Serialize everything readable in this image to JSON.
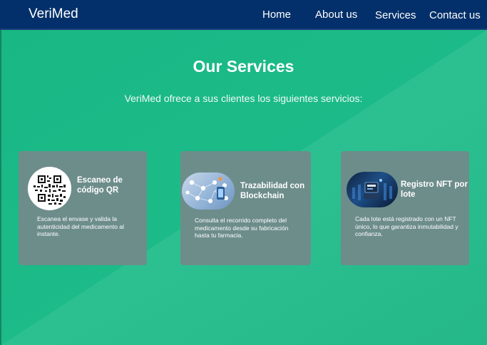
{
  "navbar": {
    "brand": "VeriMed",
    "links": [
      "Home",
      "About us",
      "Services",
      "Contact us"
    ]
  },
  "hero": {
    "title": "Our Services",
    "subtitle": "VeriMed ofrece a sus clientes los siguientes servicios:"
  },
  "services": [
    {
      "icon": "qr-code-icon",
      "title": "Escaneo de código QR",
      "description": "Escanea el envase y valida la autenticidad del medicamento al instante."
    },
    {
      "icon": "blockchain-network-icon",
      "title": "Trazabilidad con Blockchain",
      "description": "Consulta el recorrido completo del medicamento desde su fabricación hasta tu farmacia."
    },
    {
      "icon": "nft-token-icon",
      "title": "Registro NFT por lote",
      "description": "Cada lote está registrado con un NFT único, lo que garantiza inmutabilidad y confianza."
    }
  ],
  "colors": {
    "navbar": "#03306a",
    "background": "#1bb885",
    "card": "#6d8d8b"
  }
}
